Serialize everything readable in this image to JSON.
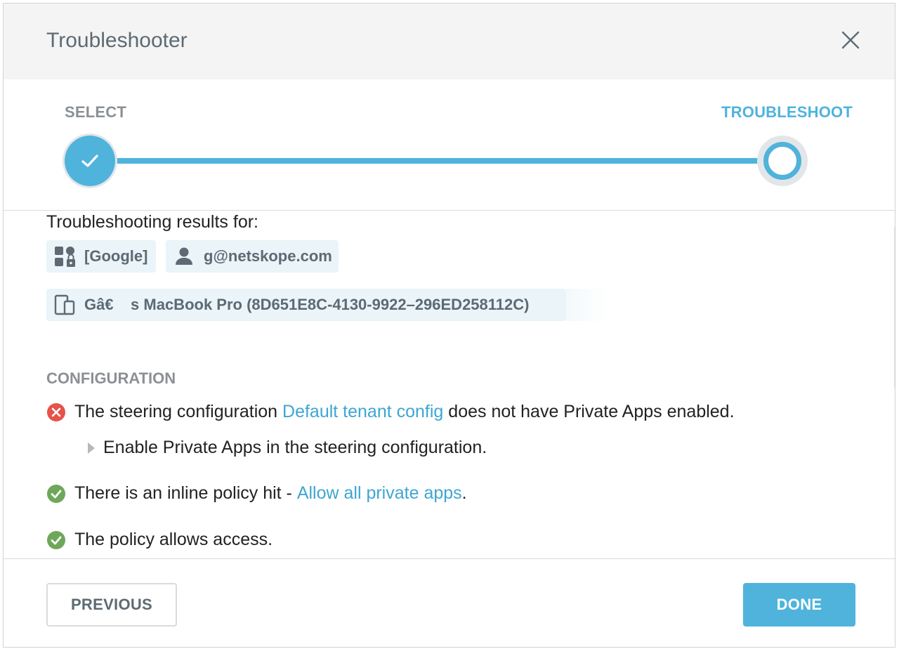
{
  "dialog": {
    "title": "Troubleshooter",
    "close_icon": "close-icon"
  },
  "stepper": {
    "steps": [
      {
        "label": "SELECT",
        "status": "complete"
      },
      {
        "label": "TROUBLESHOOT",
        "status": "current"
      }
    ],
    "accent_color": "#4fb3dc"
  },
  "results": {
    "heading": "Troubleshooting results for:",
    "app": {
      "icon": "private-app-icon",
      "label": "[Google]"
    },
    "user": {
      "icon": "user-icon",
      "label": "g@netskope.com"
    },
    "device": {
      "icon": "devices-icon",
      "label": "Gâ€    s MacBook Pro (8D651E8C-4130-9922–296ED258112C)"
    }
  },
  "configuration": {
    "section_label": "CONFIGURATION",
    "items": [
      {
        "status": "error",
        "text_before": "The steering configuration ",
        "link": "Default tenant config",
        "text_after": " does not have Private Apps enabled.",
        "remedy": "Enable Private Apps in the steering configuration."
      },
      {
        "status": "success",
        "text_before": "There is an inline policy hit - ",
        "link": "Allow all private apps",
        "text_after": "."
      },
      {
        "status": "success",
        "text_before": "The policy allows access."
      }
    ],
    "error_color": "#e5534b",
    "success_color": "#6ea75a"
  },
  "footer": {
    "previous_label": "PREVIOUS",
    "done_label": "DONE"
  }
}
